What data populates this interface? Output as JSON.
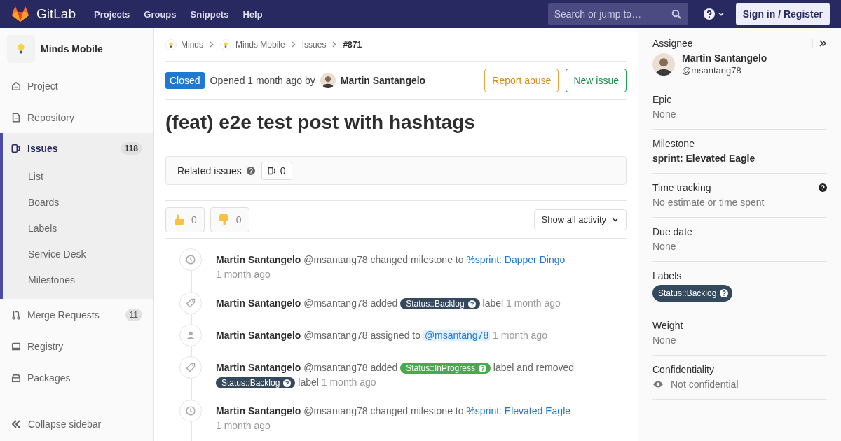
{
  "header": {
    "brand": "GitLab",
    "nav": [
      "Projects",
      "Groups",
      "Snippets",
      "Help"
    ],
    "search": {
      "placeholder": "Search or jump to…"
    },
    "signin": "Sign in / Register"
  },
  "sidebar": {
    "project": "Minds Mobile",
    "items": [
      {
        "kind": "home",
        "label": "Project",
        "selected": false
      },
      {
        "kind": "doc",
        "label": "Repository",
        "selected": false
      },
      {
        "kind": "issues",
        "label": "Issues",
        "count": "118",
        "selected": true,
        "children": [
          {
            "label": "List"
          },
          {
            "label": "Boards"
          },
          {
            "label": "Labels"
          },
          {
            "label": "Service Desk"
          },
          {
            "label": "Milestones"
          }
        ]
      },
      {
        "kind": "merge",
        "label": "Merge Requests",
        "count": "11",
        "selected": false
      },
      {
        "kind": "registry",
        "label": "Registry",
        "selected": false
      },
      {
        "kind": "package",
        "label": "Packages",
        "selected": false
      }
    ],
    "collapse": "Collapse sidebar"
  },
  "breadcrumbs": [
    {
      "label": "Minds",
      "avatar": true
    },
    {
      "label": "Minds Mobile",
      "avatar": true
    },
    {
      "label": "Issues",
      "avatar": false
    },
    {
      "label": "#871",
      "avatar": false
    }
  ],
  "issue": {
    "status": "Closed",
    "opened": "Opened 1 month ago by",
    "author": "Martin Santangelo",
    "buttons": [
      {
        "kind": "warning",
        "label": "Report abuse"
      },
      {
        "kind": "success",
        "label": "New issue"
      }
    ],
    "title": "(feat) e2e test post with hashtags"
  },
  "related": {
    "label": "Related issues",
    "count": "0"
  },
  "awards": [
    {
      "kind": "thumbsup",
      "count": "0"
    },
    {
      "kind": "thumbsdown",
      "count": "0"
    }
  ],
  "activity_filter": "Show all activity",
  "notes": [
    {
      "kind": "clock",
      "parts": [
        {
          "kind": "author",
          "text": "Martin Santangelo"
        },
        {
          "kind": "text",
          "text": "@msantang78 changed milestone to"
        },
        {
          "kind": "link",
          "text": "%sprint: Dapper Dingo"
        },
        {
          "kind": "break"
        },
        {
          "kind": "time",
          "text": "1 month ago"
        }
      ]
    },
    {
      "kind": "tag",
      "parts": [
        {
          "kind": "author",
          "text": "Martin Santangelo"
        },
        {
          "kind": "text",
          "text": "@msantang78 added"
        },
        {
          "kind": "label",
          "text": "Status::Backlog",
          "color": "#34495e"
        },
        {
          "kind": "text",
          "text": "label"
        },
        {
          "kind": "time",
          "text": "1 month ago"
        }
      ]
    },
    {
      "kind": "user",
      "parts": [
        {
          "kind": "author",
          "text": "Martin Santangelo"
        },
        {
          "kind": "text",
          "text": "@msantang78 assigned to"
        },
        {
          "kind": "mention",
          "text": "@msantang78"
        },
        {
          "kind": "time",
          "text": "1 month ago"
        }
      ]
    },
    {
      "kind": "tag",
      "parts": [
        {
          "kind": "author",
          "text": "Martin Santangelo"
        },
        {
          "kind": "text",
          "text": "@msantang78 added"
        },
        {
          "kind": "label",
          "text": "Status::InProgress",
          "color": "#44ad4b"
        },
        {
          "kind": "text",
          "text": "label and removed"
        },
        {
          "kind": "break"
        },
        {
          "kind": "label",
          "text": "Status::Backlog",
          "color": "#34495e"
        },
        {
          "kind": "text",
          "text": "label"
        },
        {
          "kind": "time",
          "text": "1 month ago"
        }
      ]
    },
    {
      "kind": "clock",
      "parts": [
        {
          "kind": "author",
          "text": "Martin Santangelo"
        },
        {
          "kind": "text",
          "text": "@msantang78 changed milestone to"
        },
        {
          "kind": "link",
          "text": "%sprint: Elevated Eagle"
        },
        {
          "kind": "break"
        },
        {
          "kind": "time",
          "text": "1 month ago"
        }
      ]
    }
  ],
  "right": {
    "assignee": {
      "title": "Assignee",
      "name": "Martin Santangelo",
      "handle": "@msantang78"
    },
    "sections": [
      {
        "kind": "muted",
        "title": "Epic",
        "value": "None"
      },
      {
        "kind": "bold",
        "title": "Milestone",
        "value": "sprint: Elevated Eagle"
      },
      {
        "kind": "help",
        "title": "Time tracking",
        "value": "No estimate or time spent"
      },
      {
        "kind": "muted",
        "title": "Due date",
        "value": "None"
      },
      {
        "kind": "label",
        "title": "Labels",
        "value": "Status::Backlog",
        "color": "#34495e"
      },
      {
        "kind": "muted",
        "title": "Weight",
        "value": "None"
      },
      {
        "kind": "eye",
        "title": "Confidentiality",
        "value": "Not confidential"
      }
    ]
  }
}
